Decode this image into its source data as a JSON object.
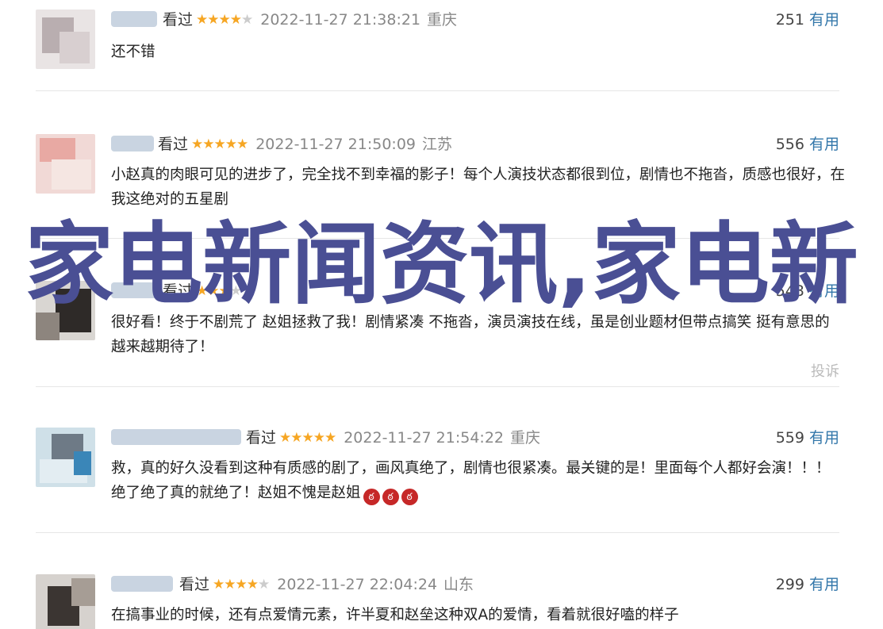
{
  "reviews": [
    {
      "status": "看过",
      "rating": 4,
      "time": "2022-11-27 21:38:21",
      "location": "重庆",
      "useful_count": "251",
      "useful_label": "有用",
      "text": "还不错"
    },
    {
      "status": "看过",
      "rating": 5,
      "time": "2022-11-27 21:50:09",
      "location": "江苏",
      "useful_count": "556",
      "useful_label": "有用",
      "text": "小赵真的肉眼可见的进步了，完全找不到幸福的影子！每个人演技状态都很到位，剧情也不拖沓，质感也很好，在我这绝对的五星剧"
    },
    {
      "status": "看过",
      "rating": 3,
      "time": "",
      "location": "",
      "useful_count": "543",
      "useful_label": "有用",
      "text": "很好看！终于不剧荒了 赵姐拯救了我！剧情紧凑 不拖沓，演员演技在线，虽是创业题材但带点搞笑 挺有意思的 越来越期待了！",
      "report_label": "投诉"
    },
    {
      "status": "看过",
      "rating": 5,
      "time": "2022-11-27 21:54:22",
      "location": "重庆",
      "useful_count": "559",
      "useful_label": "有用",
      "text": "救，真的好久没看到这种有质感的剧了，画风真绝了，剧情也很紧凑。最关键的是！里面每个人都好会演！！！ 绝了绝了真的就绝了！赵姐不愧是赵姐"
    },
    {
      "status": "看过",
      "rating": 4,
      "time": "2022-11-27 22:04:24",
      "location": "山东",
      "useful_count": "299",
      "useful_label": "有用",
      "text": "在搞事业的时候，还有点爱情元素，许半夏和赵垒这种双A的爱情，看着就很好嗑的样子"
    }
  ],
  "overlay_title": "家电新闻资讯,家电新",
  "colors": {
    "star": "#f6a623",
    "useful_link": "#3377aa",
    "overlay": "#4a4f94"
  }
}
